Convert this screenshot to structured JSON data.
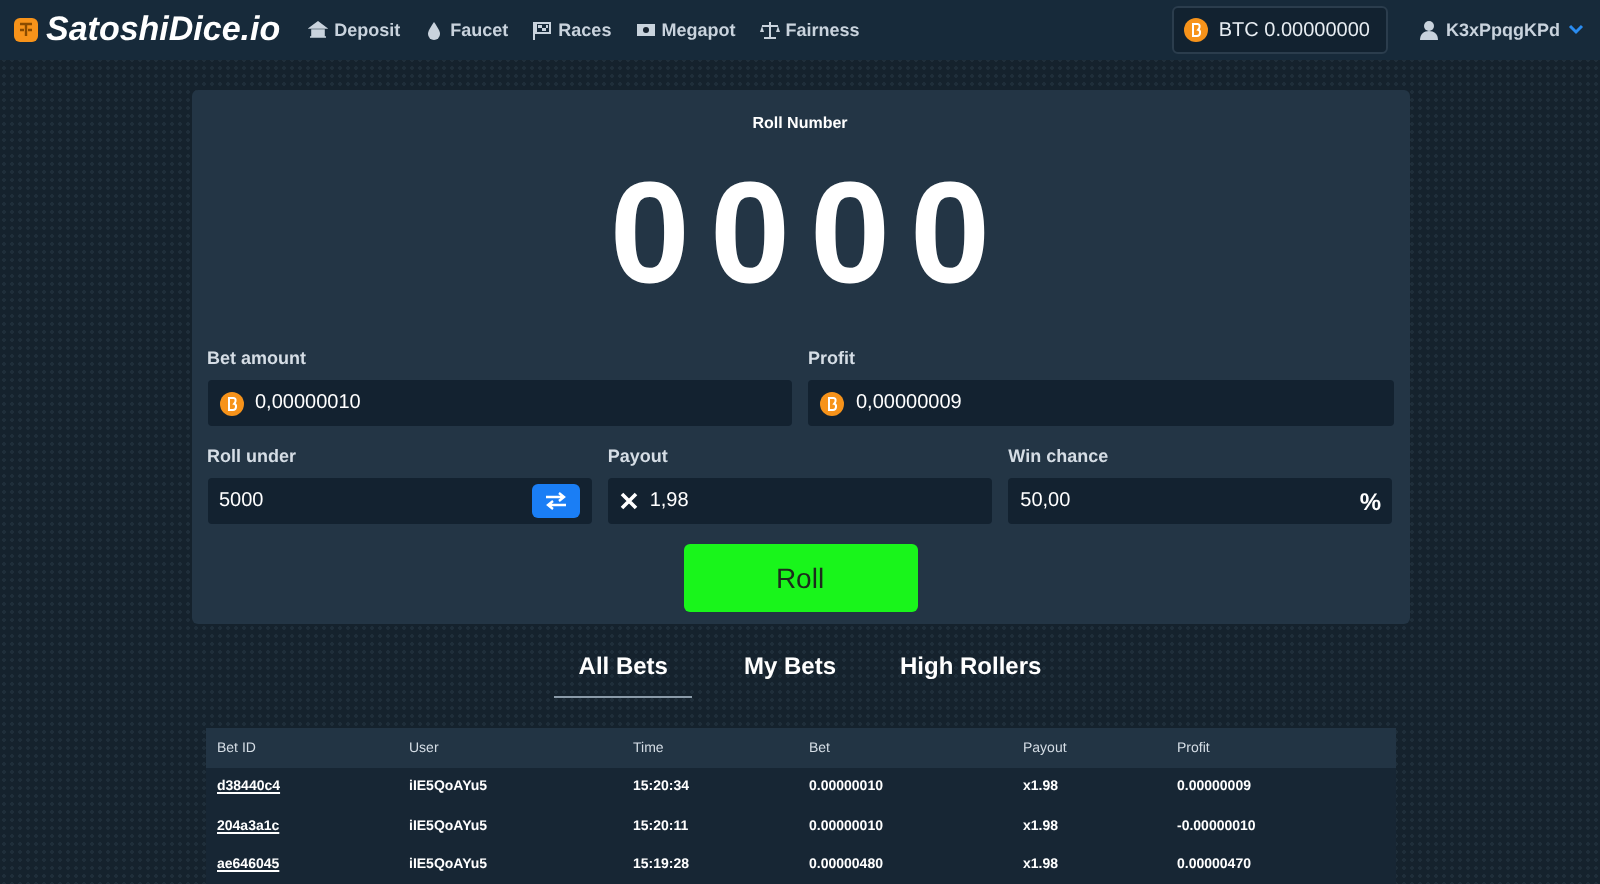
{
  "header": {
    "logo": "SatoshiDice.io",
    "nav": [
      {
        "label": "Deposit",
        "kind": "deposit"
      },
      {
        "label": "Faucet",
        "kind": "faucet"
      },
      {
        "label": "Races",
        "kind": "races"
      },
      {
        "label": "Megapot",
        "kind": "megapot"
      },
      {
        "label": "Fairness",
        "kind": "fairness"
      }
    ],
    "balance": "BTC 0.00000000",
    "user": "K3xPpqgKPd"
  },
  "game": {
    "title": "Roll Number",
    "roll": "0000",
    "fields": [
      [
        {
          "label": "Bet amount",
          "value": "0,00000010",
          "kind": "coin"
        },
        {
          "label": "Profit",
          "value": "0,00000009",
          "kind": "coin"
        }
      ],
      [
        {
          "label": "Roll under",
          "value": "5000",
          "kind": "swap"
        },
        {
          "label": "Payout",
          "value": "1,98",
          "kind": "times"
        },
        {
          "label": "Win chance",
          "value": "50,00",
          "kind": "percent",
          "suffix": "%"
        }
      ]
    ],
    "roll_button": "Roll"
  },
  "tabs": [
    {
      "label": "All Bets",
      "selected": true
    },
    {
      "label": "My Bets",
      "selected": false
    },
    {
      "label": "High Rollers",
      "selected": false
    }
  ],
  "table": {
    "columns": [
      "Bet ID",
      "User",
      "Time",
      "Bet",
      "Payout",
      "Profit"
    ],
    "rows": [
      [
        "d38440c4",
        "iIE5QoAYu5",
        "15:20:34",
        "0.00000010",
        "x1.98",
        "0.00000009"
      ],
      [
        "204a3a1c",
        "iIE5QoAYu5",
        "15:20:11",
        "0.00000010",
        "x1.98",
        "-0.00000010"
      ],
      [
        "ae646045",
        "iIE5QoAYu5",
        "15:19:28",
        "0.00000480",
        "x1.98",
        "0.00000470"
      ]
    ]
  }
}
